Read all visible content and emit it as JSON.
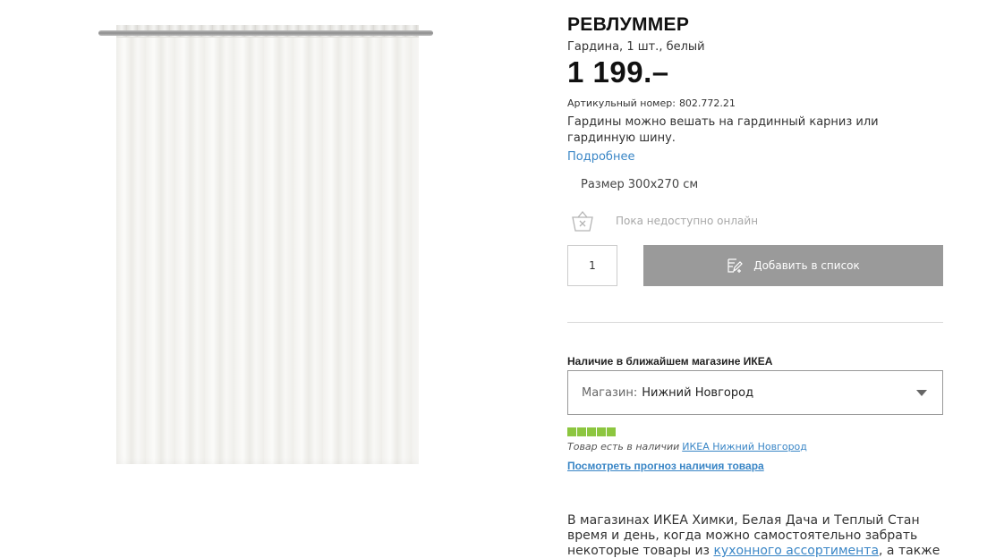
{
  "product": {
    "name": "РЕВЛУММЕР",
    "description": "Гардина, 1 шт., белый",
    "price": "1 199.–",
    "article_label": "Артикульный номер:",
    "article_number": "802.772.21",
    "summary": "Гардины можно вешать на гардинный карниз или гардинную шину.",
    "more_link": "Подробнее",
    "image_icon": "curtain-image"
  },
  "size": {
    "label": "Размер",
    "value": "300x270 см"
  },
  "availability": {
    "online_text": "Пока недоступно онлайн",
    "icon": "basket-unavailable-icon"
  },
  "purchase": {
    "quantity": "1",
    "add_to_list_label": "Добавить в список",
    "add_icon": "edit-list-icon"
  },
  "store": {
    "heading": "Наличие в ближайшем магазине ИКЕА",
    "select_label": "Магазин:",
    "select_value": "Нижний Новгород",
    "stock_level": 5,
    "stock_max": 5,
    "stock_color": "#8cc63f",
    "stock_text": "Товар есть в наличии",
    "stock_store_link": "ИКЕА Нижний Новгород",
    "forecast_link": "Посмотреть прогноз наличия товара"
  },
  "promo": {
    "text_line1": "В магазинах ИКЕА Химки, Белая Дача и Теплый Стан",
    "text_line2": "время и день, когда можно самостоятельно забрать",
    "text_line3_start": "некоторые товары из",
    "text_link": "кухонного ассортимента",
    "text_line3_end": ", а также"
  },
  "colors": {
    "link": "#3a86c6",
    "button_disabled": "#9a9a9a"
  }
}
